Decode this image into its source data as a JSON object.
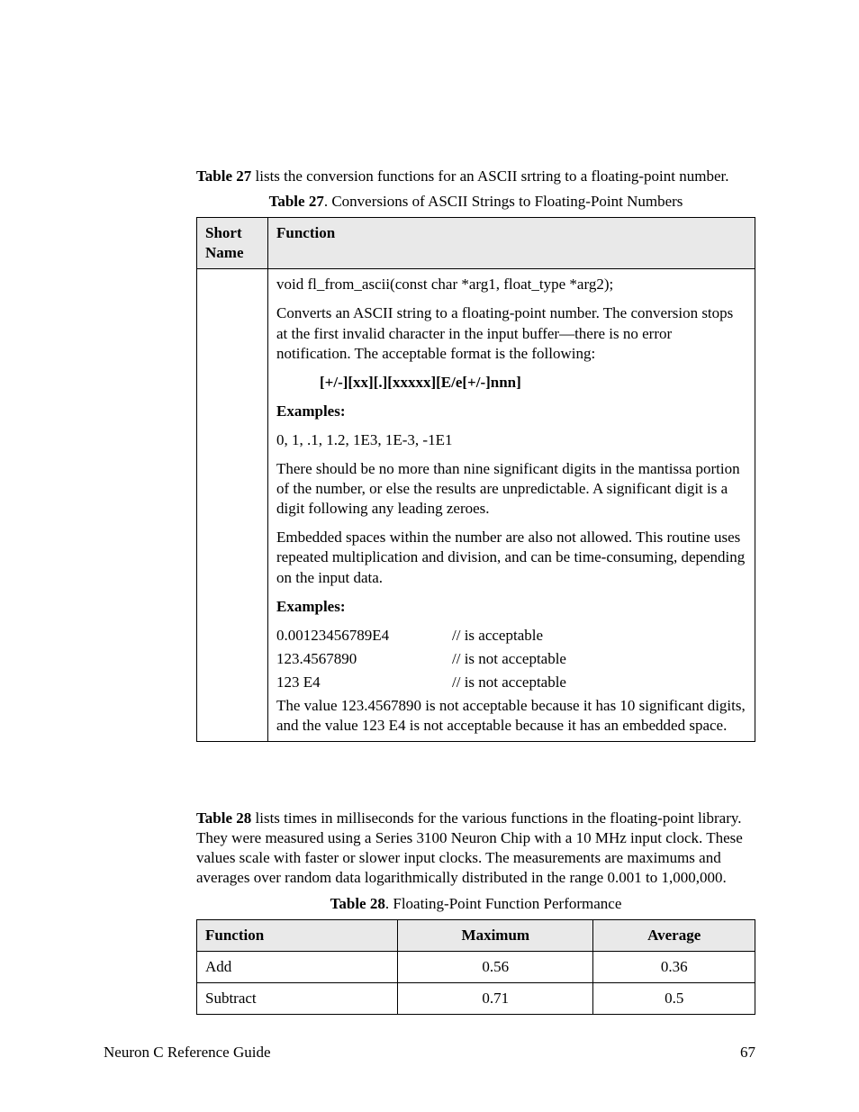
{
  "intro27_prefix": "Table 27",
  "intro27_rest": " lists the conversion functions for an ASCII srtring to a floating-point number.",
  "caption27_prefix": "Table 27",
  "caption27_rest": ". Conversions of ASCII Strings to Floating-Point Numbers",
  "t27": {
    "h1": "Short Name",
    "h2": "Function",
    "sig": "void fl_from_ascii(const char *arg1, float_type *arg2);",
    "desc": "Converts an ASCII string to a floating-point number.  The conversion stops at the first invalid character in the input buffer—there is no error notification.  The acceptable format is the following:",
    "format": "[+/-][xx][.][xxxxx][E/e[+/-]nnn]",
    "examples_label": "Examples:",
    "ex_list": "0, 1, .1, 1.2, 1E3, 1E-3, -1E1",
    "mantissa": "There should be no more than nine significant digits in the mantissa portion of the number, or else the results are unpredictable.  A significant digit is a digit following any leading zeroes.",
    "embedded": "Embedded spaces within the number are also not allowed.  This routine uses repeated multiplication and division, and can be time-consuming, depending on the input data.",
    "examples2_label": "Examples:",
    "ex2": {
      "r1_l": "0.00123456789E4",
      "r1_r": "// is acceptable",
      "r2_l": "123.4567890",
      "r2_r": "// is not acceptable",
      "r3_l": "123 E4",
      "r3_r": "// is not acceptable"
    },
    "final": "The value 123.4567890 is not acceptable because it has 10 significant digits, and the value 123 E4 is not acceptable because it has an embedded space."
  },
  "intro28_prefix": "Table 28",
  "intro28_rest": " lists times in milliseconds for the various functions in the floating-point library.  They were measured using a Series 3100 Neuron Chip with a 10 MHz input clock.  These values scale with faster or slower input clocks.  The measurements are maximums and averages over random data logarithmically distributed in the range 0.001 to 1,000,000.",
  "caption28_prefix": "Table 28",
  "caption28_rest": ". Floating-Point Function Performance",
  "t28": {
    "h1": "Function",
    "h2": "Maximum",
    "h3": "Average",
    "rows": [
      {
        "f": "Add",
        "max": "0.56",
        "avg": "0.36"
      },
      {
        "f": "Subtract",
        "max": "0.71",
        "avg": "0.5"
      }
    ]
  },
  "chart_data": {
    "type": "table",
    "title": "Floating-Point Function Performance",
    "columns": [
      "Function",
      "Maximum",
      "Average"
    ],
    "rows": [
      [
        "Add",
        0.56,
        0.36
      ],
      [
        "Subtract",
        0.71,
        0.5
      ]
    ],
    "units": "milliseconds"
  },
  "footer_left": "Neuron C Reference Guide",
  "footer_right": "67"
}
